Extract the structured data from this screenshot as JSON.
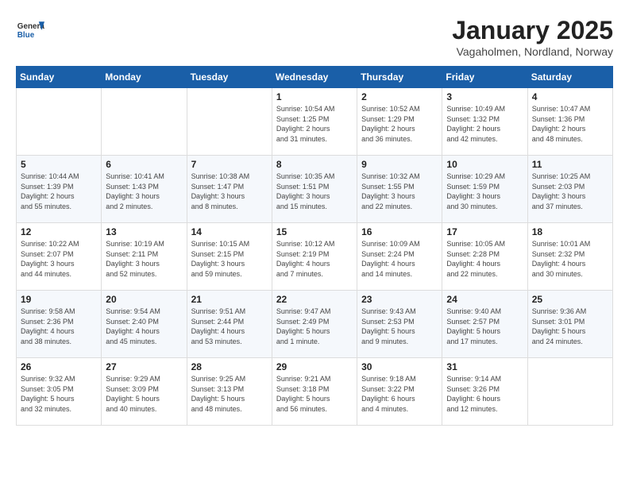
{
  "header": {
    "logo_general": "General",
    "logo_blue": "Blue",
    "title": "January 2025",
    "subtitle": "Vagaholmen, Nordland, Norway"
  },
  "weekdays": [
    "Sunday",
    "Monday",
    "Tuesday",
    "Wednesday",
    "Thursday",
    "Friday",
    "Saturday"
  ],
  "weeks": [
    [
      {
        "day": "",
        "info": ""
      },
      {
        "day": "",
        "info": ""
      },
      {
        "day": "",
        "info": ""
      },
      {
        "day": "1",
        "info": "Sunrise: 10:54 AM\nSunset: 1:25 PM\nDaylight: 2 hours\nand 31 minutes."
      },
      {
        "day": "2",
        "info": "Sunrise: 10:52 AM\nSunset: 1:29 PM\nDaylight: 2 hours\nand 36 minutes."
      },
      {
        "day": "3",
        "info": "Sunrise: 10:49 AM\nSunset: 1:32 PM\nDaylight: 2 hours\nand 42 minutes."
      },
      {
        "day": "4",
        "info": "Sunrise: 10:47 AM\nSunset: 1:36 PM\nDaylight: 2 hours\nand 48 minutes."
      }
    ],
    [
      {
        "day": "5",
        "info": "Sunrise: 10:44 AM\nSunset: 1:39 PM\nDaylight: 2 hours\nand 55 minutes."
      },
      {
        "day": "6",
        "info": "Sunrise: 10:41 AM\nSunset: 1:43 PM\nDaylight: 3 hours\nand 2 minutes."
      },
      {
        "day": "7",
        "info": "Sunrise: 10:38 AM\nSunset: 1:47 PM\nDaylight: 3 hours\nand 8 minutes."
      },
      {
        "day": "8",
        "info": "Sunrise: 10:35 AM\nSunset: 1:51 PM\nDaylight: 3 hours\nand 15 minutes."
      },
      {
        "day": "9",
        "info": "Sunrise: 10:32 AM\nSunset: 1:55 PM\nDaylight: 3 hours\nand 22 minutes."
      },
      {
        "day": "10",
        "info": "Sunrise: 10:29 AM\nSunset: 1:59 PM\nDaylight: 3 hours\nand 30 minutes."
      },
      {
        "day": "11",
        "info": "Sunrise: 10:25 AM\nSunset: 2:03 PM\nDaylight: 3 hours\nand 37 minutes."
      }
    ],
    [
      {
        "day": "12",
        "info": "Sunrise: 10:22 AM\nSunset: 2:07 PM\nDaylight: 3 hours\nand 44 minutes."
      },
      {
        "day": "13",
        "info": "Sunrise: 10:19 AM\nSunset: 2:11 PM\nDaylight: 3 hours\nand 52 minutes."
      },
      {
        "day": "14",
        "info": "Sunrise: 10:15 AM\nSunset: 2:15 PM\nDaylight: 3 hours\nand 59 minutes."
      },
      {
        "day": "15",
        "info": "Sunrise: 10:12 AM\nSunset: 2:19 PM\nDaylight: 4 hours\nand 7 minutes."
      },
      {
        "day": "16",
        "info": "Sunrise: 10:09 AM\nSunset: 2:24 PM\nDaylight: 4 hours\nand 14 minutes."
      },
      {
        "day": "17",
        "info": "Sunrise: 10:05 AM\nSunset: 2:28 PM\nDaylight: 4 hours\nand 22 minutes."
      },
      {
        "day": "18",
        "info": "Sunrise: 10:01 AM\nSunset: 2:32 PM\nDaylight: 4 hours\nand 30 minutes."
      }
    ],
    [
      {
        "day": "19",
        "info": "Sunrise: 9:58 AM\nSunset: 2:36 PM\nDaylight: 4 hours\nand 38 minutes."
      },
      {
        "day": "20",
        "info": "Sunrise: 9:54 AM\nSunset: 2:40 PM\nDaylight: 4 hours\nand 45 minutes."
      },
      {
        "day": "21",
        "info": "Sunrise: 9:51 AM\nSunset: 2:44 PM\nDaylight: 4 hours\nand 53 minutes."
      },
      {
        "day": "22",
        "info": "Sunrise: 9:47 AM\nSunset: 2:49 PM\nDaylight: 5 hours\nand 1 minute."
      },
      {
        "day": "23",
        "info": "Sunrise: 9:43 AM\nSunset: 2:53 PM\nDaylight: 5 hours\nand 9 minutes."
      },
      {
        "day": "24",
        "info": "Sunrise: 9:40 AM\nSunset: 2:57 PM\nDaylight: 5 hours\nand 17 minutes."
      },
      {
        "day": "25",
        "info": "Sunrise: 9:36 AM\nSunset: 3:01 PM\nDaylight: 5 hours\nand 24 minutes."
      }
    ],
    [
      {
        "day": "26",
        "info": "Sunrise: 9:32 AM\nSunset: 3:05 PM\nDaylight: 5 hours\nand 32 minutes."
      },
      {
        "day": "27",
        "info": "Sunrise: 9:29 AM\nSunset: 3:09 PM\nDaylight: 5 hours\nand 40 minutes."
      },
      {
        "day": "28",
        "info": "Sunrise: 9:25 AM\nSunset: 3:13 PM\nDaylight: 5 hours\nand 48 minutes."
      },
      {
        "day": "29",
        "info": "Sunrise: 9:21 AM\nSunset: 3:18 PM\nDaylight: 5 hours\nand 56 minutes."
      },
      {
        "day": "30",
        "info": "Sunrise: 9:18 AM\nSunset: 3:22 PM\nDaylight: 6 hours\nand 4 minutes."
      },
      {
        "day": "31",
        "info": "Sunrise: 9:14 AM\nSunset: 3:26 PM\nDaylight: 6 hours\nand 12 minutes."
      },
      {
        "day": "",
        "info": ""
      }
    ]
  ]
}
